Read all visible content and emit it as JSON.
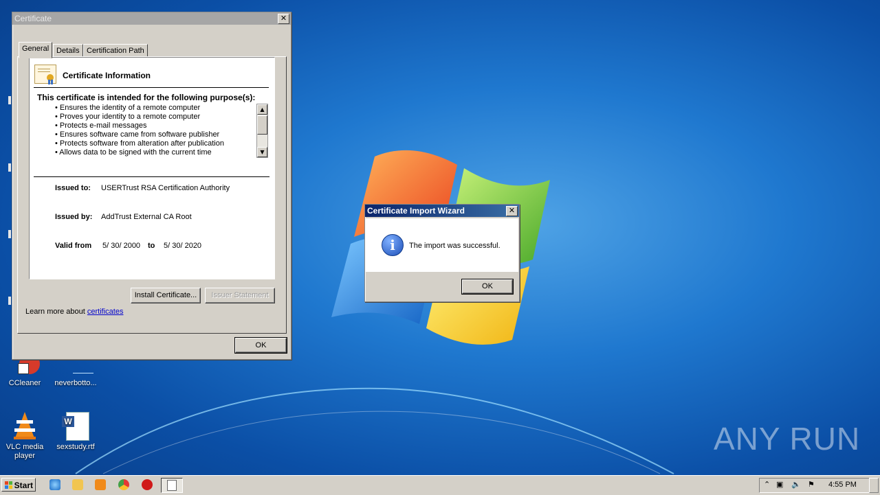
{
  "desktop": {
    "icons": [
      {
        "label": "CCleaner"
      },
      {
        "label": "neverbotto..."
      },
      {
        "label": "VLC media player"
      },
      {
        "label": "sexstudy.rtf"
      }
    ],
    "watermark": "ANY RUN"
  },
  "cert_dialog": {
    "title": "Certificate",
    "tabs": [
      "General",
      "Details",
      "Certification Path"
    ],
    "heading": "Certificate Information",
    "purpose_heading": "This certificate is intended for the following purpose(s):",
    "purposes": [
      "• Ensures the identity of a remote computer",
      "• Proves your identity to a remote computer",
      "• Protects e-mail messages",
      "• Ensures software came from software publisher",
      "• Protects software from alteration after publication",
      "• Allows data to be signed with the current time"
    ],
    "issued_to_label": "Issued to:",
    "issued_to": "USERTrust RSA Certification Authority",
    "issued_by_label": "Issued by:",
    "issued_by": "AddTrust External CA Root",
    "valid_from_label": "Valid from",
    "valid_from": "5/ 30/ 2000",
    "valid_to_label": "to",
    "valid_to": "5/ 30/ 2020",
    "install_button": "Install Certificate...",
    "issuer_statement_button": "Issuer Statement",
    "learn_more_prefix": "Learn more about",
    "learn_more_link": "certificates",
    "ok_button": "OK",
    "close_glyph": "✕"
  },
  "import_wizard": {
    "title": "Certificate Import Wizard",
    "message": "The import was successful.",
    "ok_button": "OK",
    "close_glyph": "✕"
  },
  "taskbar": {
    "start_label": "Start",
    "clock": "4:55 PM"
  },
  "colors": {
    "dialog_face": "#d4d0c8",
    "active_title": "#0a246a",
    "inactive_title": "#a6a6a6",
    "link": "#0000cc"
  }
}
